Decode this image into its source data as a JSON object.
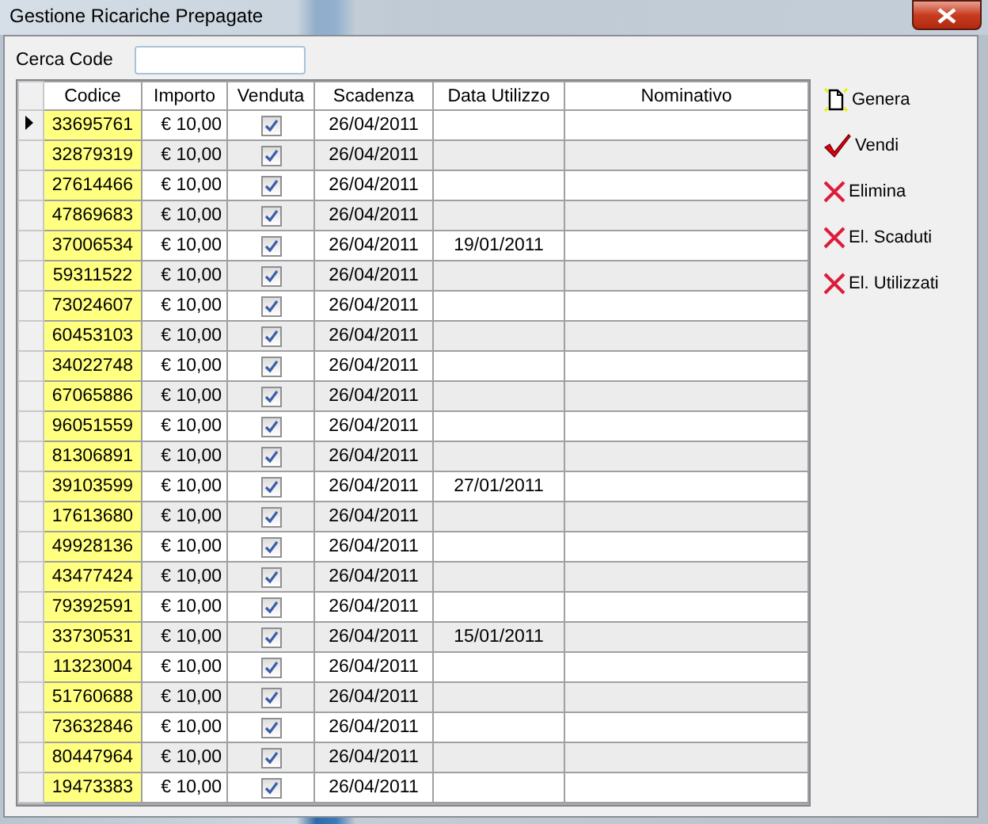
{
  "window": {
    "title": "Gestione Ricariche Prepagate"
  },
  "search": {
    "label": "Cerca Code"
  },
  "table": {
    "columns": [
      "Codice",
      "Importo",
      "Venduta",
      "Scadenza",
      "Data Utilizzo",
      "Nominativo"
    ],
    "rows": [
      {
        "current": true,
        "codice": "33695761",
        "importo": "€ 10,00",
        "venduta": true,
        "scadenza": "26/04/2011"
      },
      {
        "current": false,
        "codice": "32879319",
        "importo": "€ 10,00",
        "venduta": true,
        "scadenza": "26/04/2011"
      },
      {
        "current": false,
        "codice": "27614466",
        "importo": "€ 10,00",
        "venduta": true,
        "scadenza": "26/04/2011"
      },
      {
        "current": false,
        "codice": "47869683",
        "importo": "€ 10,00",
        "venduta": true,
        "scadenza": "26/04/2011"
      },
      {
        "current": false,
        "codice": "37006534",
        "importo": "€ 10,00",
        "venduta": true,
        "scadenza": "26/04/2011",
        "data_utilizzo": "19/01/2011"
      },
      {
        "current": false,
        "codice": "59311522",
        "importo": "€ 10,00",
        "venduta": true,
        "scadenza": "26/04/2011"
      },
      {
        "current": false,
        "codice": "73024607",
        "importo": "€ 10,00",
        "venduta": true,
        "scadenza": "26/04/2011"
      },
      {
        "current": false,
        "codice": "60453103",
        "importo": "€ 10,00",
        "venduta": true,
        "scadenza": "26/04/2011"
      },
      {
        "current": false,
        "codice": "34022748",
        "importo": "€ 10,00",
        "venduta": true,
        "scadenza": "26/04/2011"
      },
      {
        "current": false,
        "codice": "67065886",
        "importo": "€ 10,00",
        "venduta": true,
        "scadenza": "26/04/2011"
      },
      {
        "current": false,
        "codice": "96051559",
        "importo": "€ 10,00",
        "venduta": true,
        "scadenza": "26/04/2011"
      },
      {
        "current": false,
        "codice": "81306891",
        "importo": "€ 10,00",
        "venduta": true,
        "scadenza": "26/04/2011"
      },
      {
        "current": false,
        "codice": "39103599",
        "importo": "€ 10,00",
        "venduta": true,
        "scadenza": "26/04/2011",
        "data_utilizzo": "27/01/2011"
      },
      {
        "current": false,
        "codice": "17613680",
        "importo": "€ 10,00",
        "venduta": true,
        "scadenza": "26/04/2011"
      },
      {
        "current": false,
        "codice": "49928136",
        "importo": "€ 10,00",
        "venduta": true,
        "scadenza": "26/04/2011"
      },
      {
        "current": false,
        "codice": "43477424",
        "importo": "€ 10,00",
        "venduta": true,
        "scadenza": "26/04/2011"
      },
      {
        "current": false,
        "codice": "79392591",
        "importo": "€ 10,00",
        "venduta": true,
        "scadenza": "26/04/2011"
      },
      {
        "current": false,
        "codice": "33730531",
        "importo": "€ 10,00",
        "venduta": true,
        "scadenza": "26/04/2011",
        "data_utilizzo": "15/01/2011"
      },
      {
        "current": false,
        "codice": "11323004",
        "importo": "€ 10,00",
        "venduta": true,
        "scadenza": "26/04/2011"
      },
      {
        "current": false,
        "codice": "51760688",
        "importo": "€ 10,00",
        "venduta": true,
        "scadenza": "26/04/2011"
      },
      {
        "current": false,
        "codice": "73632846",
        "importo": "€ 10,00",
        "venduta": true,
        "scadenza": "26/04/2011"
      },
      {
        "current": false,
        "codice": "80447964",
        "importo": "€ 10,00",
        "venduta": true,
        "scadenza": "26/04/2011"
      },
      {
        "current": false,
        "codice": "19473383",
        "importo": "€ 10,00",
        "venduta": true,
        "scadenza": "26/04/2011"
      }
    ]
  },
  "actions": [
    {
      "label": "Genera",
      "kind": "new"
    },
    {
      "label": "Vendi",
      "kind": "sell"
    },
    {
      "label": "Elimina",
      "kind": "delete"
    },
    {
      "label": "El. Scaduti",
      "kind": "delete"
    },
    {
      "label": "El. Utilizzati",
      "kind": "delete"
    }
  ]
}
